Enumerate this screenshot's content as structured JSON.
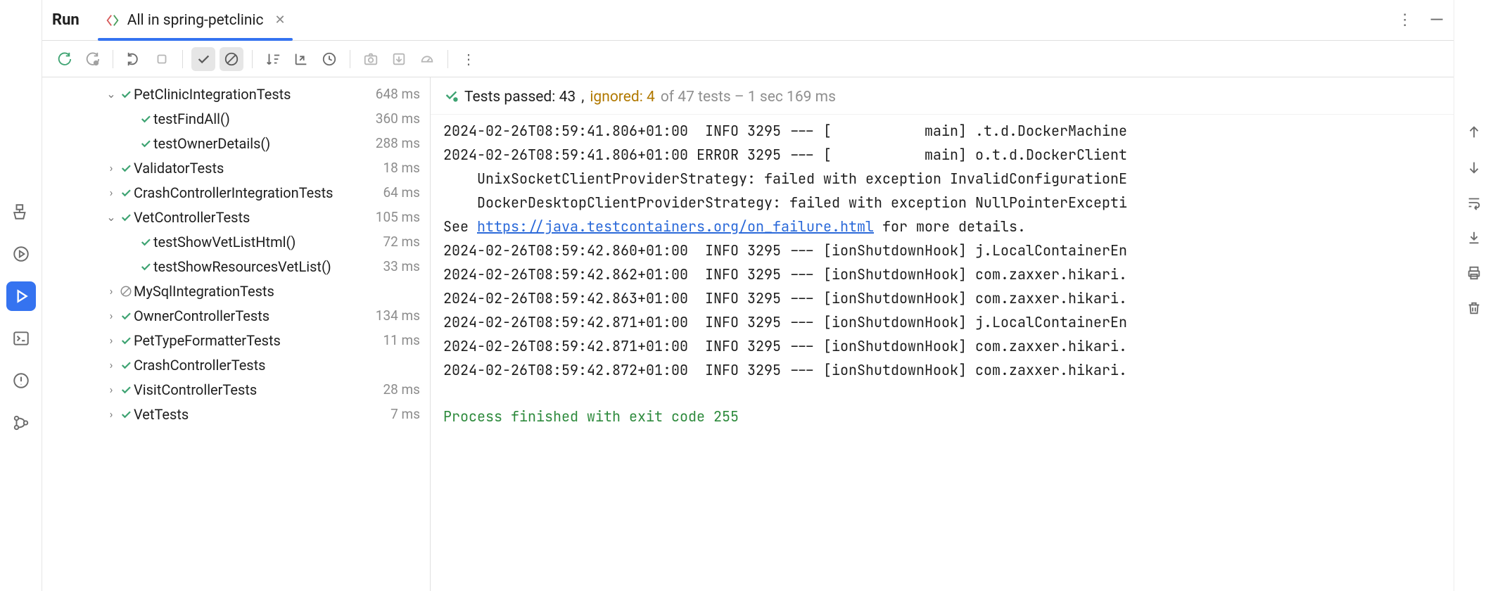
{
  "tabs": {
    "run_label": "Run",
    "active_tab": "All in spring-petclinic"
  },
  "summary": {
    "icon": "tests-passed-icon",
    "passed_prefix": "Tests passed: ",
    "passed_count": "43",
    "sep": ", ",
    "ignored_prefix": "ignored: ",
    "ignored_count": "4",
    "rest": " of 47 tests – 1 sec 169 ms"
  },
  "tree": [
    {
      "indent": 1,
      "chev": "down",
      "status": "pass",
      "name": "PetClinicIntegrationTests",
      "time": "648 ms"
    },
    {
      "indent": 2,
      "chev": "",
      "status": "pass",
      "name": "testFindAll()",
      "time": "360 ms"
    },
    {
      "indent": 2,
      "chev": "",
      "status": "pass",
      "name": "testOwnerDetails()",
      "time": "288 ms"
    },
    {
      "indent": 1,
      "chev": "right",
      "status": "pass",
      "name": "ValidatorTests",
      "time": "18 ms"
    },
    {
      "indent": 1,
      "chev": "right",
      "status": "pass",
      "name": "CrashControllerIntegrationTests",
      "time": "64 ms"
    },
    {
      "indent": 1,
      "chev": "down",
      "status": "pass",
      "name": "VetControllerTests",
      "time": "105 ms"
    },
    {
      "indent": 2,
      "chev": "",
      "status": "pass",
      "name": "testShowVetListHtml()",
      "time": "72 ms"
    },
    {
      "indent": 2,
      "chev": "",
      "status": "pass",
      "name": "testShowResourcesVetList()",
      "time": "33 ms"
    },
    {
      "indent": 1,
      "chev": "right",
      "status": "skip",
      "name": "MySqlIntegrationTests",
      "time": ""
    },
    {
      "indent": 1,
      "chev": "right",
      "status": "pass",
      "name": "OwnerControllerTests",
      "time": "134 ms"
    },
    {
      "indent": 1,
      "chev": "right",
      "status": "pass",
      "name": "PetTypeFormatterTests",
      "time": "11 ms"
    },
    {
      "indent": 1,
      "chev": "right",
      "status": "pass",
      "name": "CrashControllerTests",
      "time": ""
    },
    {
      "indent": 1,
      "chev": "right",
      "status": "pass",
      "name": "VisitControllerTests",
      "time": "28 ms"
    },
    {
      "indent": 1,
      "chev": "right",
      "status": "pass",
      "name": "VetTests",
      "time": "7 ms"
    }
  ],
  "log_lines": [
    {
      "t": "2024-02-26T08:59:41.806+01:00  INFO 3295 --- [           main] .t.d.DockerMachine"
    },
    {
      "t": "2024-02-26T08:59:41.806+01:00 ERROR 3295 --- [           main] o.t.d.DockerClient"
    },
    {
      "t": "    UnixSocketClientProviderStrategy: failed with exception InvalidConfigurationE"
    },
    {
      "t": "    DockerDesktopClientProviderStrategy: failed with exception NullPointerExcepti"
    },
    {
      "prefix": "See ",
      "link": "https://java.testcontainers.org/on_failure.html",
      "suffix": " for more details."
    },
    {
      "t": "2024-02-26T08:59:42.860+01:00  INFO 3295 --- [ionShutdownHook] j.LocalContainerEn"
    },
    {
      "t": "2024-02-26T08:59:42.862+01:00  INFO 3295 --- [ionShutdownHook] com.zaxxer.hikari."
    },
    {
      "t": "2024-02-26T08:59:42.863+01:00  INFO 3295 --- [ionShutdownHook] com.zaxxer.hikari."
    },
    {
      "t": "2024-02-26T08:59:42.871+01:00  INFO 3295 --- [ionShutdownHook] j.LocalContainerEn"
    },
    {
      "t": "2024-02-26T08:59:42.871+01:00  INFO 3295 --- [ionShutdownHook] com.zaxxer.hikari."
    },
    {
      "t": "2024-02-26T08:59:42.872+01:00  INFO 3295 --- [ionShutdownHook] com.zaxxer.hikari."
    }
  ],
  "process_line": "Process finished with exit code 255"
}
